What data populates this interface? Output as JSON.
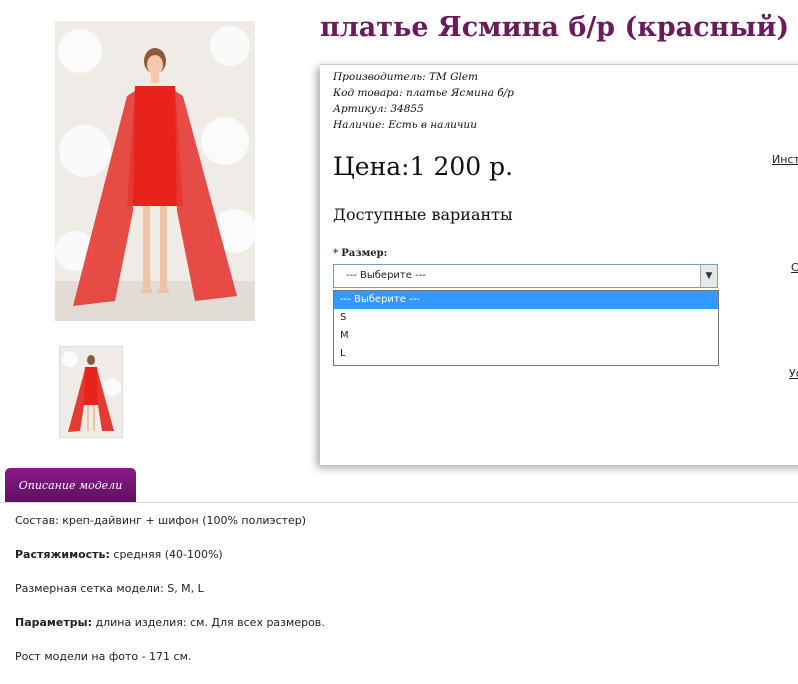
{
  "product": {
    "title": "платье Ясмина б/р (красный)",
    "meta": [
      {
        "label": "Производитель:",
        "value": "TM Glem"
      },
      {
        "label": "Код товара:",
        "value": "платье Ясмина б/р"
      },
      {
        "label": "Артикул:",
        "value": "34855"
      },
      {
        "label": "Наличие:",
        "value": "Есть в наличии"
      }
    ],
    "price": "Цена:1 200 р.",
    "variants_heading": "Доступные варианты",
    "size_label": "Размер:",
    "size_select_value": "--- Выберите ---",
    "size_options": [
      "--- Выберите ---",
      "S",
      "M",
      "L"
    ],
    "side_links": [
      "Инст",
      "С",
      "Ус"
    ]
  },
  "description": {
    "tab_label": "Описание модели",
    "lines": [
      {
        "bold": "",
        "text": "Состав: креп-дайвинг + шифон (100% полиэстер)"
      },
      {
        "bold": "Растяжимость:",
        "text": " средняя (40-100%)"
      },
      {
        "bold": "",
        "text": "Размерная сетка модели: S, M, L"
      },
      {
        "bold": "Параметры:",
        "text": " длина изделия: см. Для всех размеров."
      },
      {
        "bold": "",
        "text": "Рост модели на фото - 171 см."
      }
    ]
  },
  "colors": {
    "title": "#6a1b5c",
    "tab": "#7a1777",
    "dress": "#e8231c",
    "select_highlight": "#3399ff"
  },
  "icons": {
    "main_image": "product-photo-woman-red-dress",
    "thumbnail": "product-thumbnail",
    "select_arrow": "chevron-down-icon"
  }
}
